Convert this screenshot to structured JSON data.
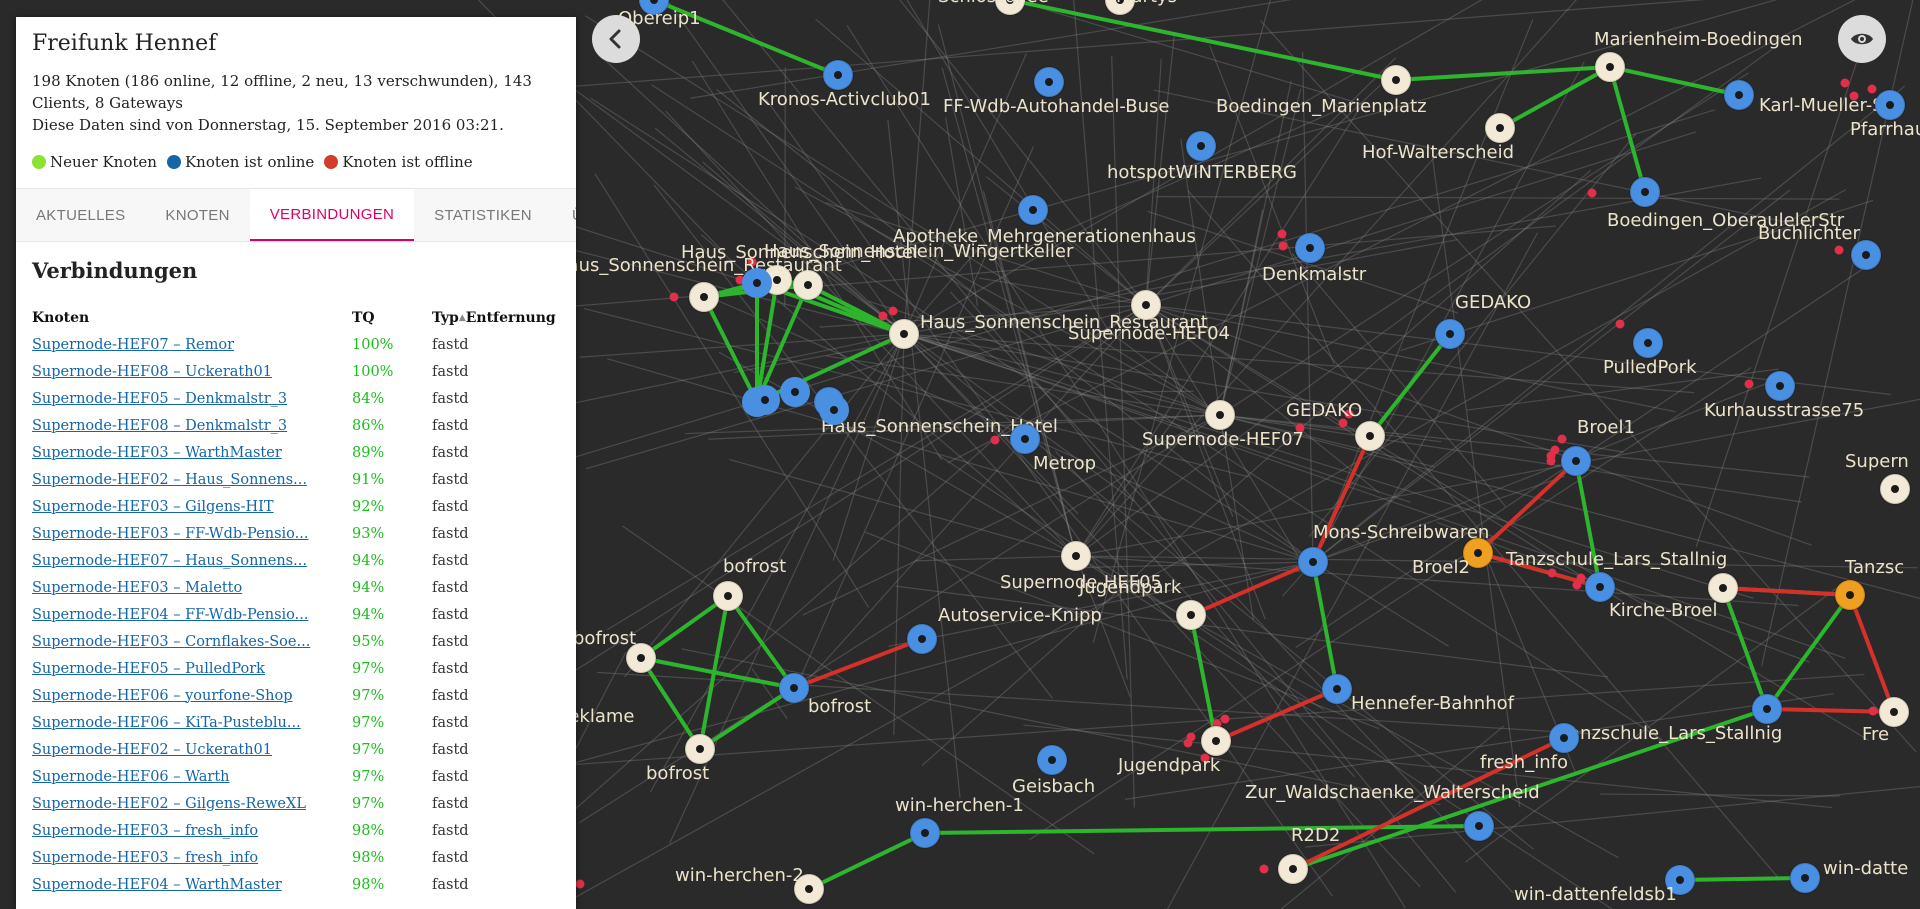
{
  "header": {
    "title": "Freifunk Hennef",
    "stats_line": "198 Knoten (186 online, 12 offline, 2 neu, 13 verschwunden), 143 Clients, 8 Gateways",
    "date_line": "Diese Daten sind von Donnerstag, 15. September 2016 03:21."
  },
  "legend": [
    {
      "label": "Neuer Knoten",
      "color": "#8ae234"
    },
    {
      "label": "Knoten ist online",
      "color": "#1566a9"
    },
    {
      "label": "Knoten ist offline",
      "color": "#d23c2c"
    }
  ],
  "tabs": [
    {
      "label": "AKTUELLES",
      "active": false
    },
    {
      "label": "KNOTEN",
      "active": false
    },
    {
      "label": "VERBINDUNGEN",
      "active": true
    },
    {
      "label": "STATISTIKEN",
      "active": false
    },
    {
      "label": "ÜBER",
      "active": false
    }
  ],
  "connections": {
    "heading": "Verbindungen",
    "columns": {
      "knoten": "Knoten",
      "tq": "TQ",
      "typ": "Typ",
      "entfernung": "Entfernung",
      "sort_indicator": "▲"
    },
    "rows": [
      {
        "name": "Supernode-HEF07 – Remor",
        "tq": "100%",
        "typ": "fastd"
      },
      {
        "name": "Supernode-HEF08 – Uckerath01",
        "tq": "100%",
        "typ": "fastd"
      },
      {
        "name": "Supernode-HEF05 – Denkmalstr_3",
        "tq": "84%",
        "typ": "fastd"
      },
      {
        "name": "Supernode-HEF08 – Denkmalstr_3",
        "tq": "86%",
        "typ": "fastd"
      },
      {
        "name": "Supernode-HEF03 – WarthMaster",
        "tq": "89%",
        "typ": "fastd"
      },
      {
        "name": "Supernode-HEF02 – Haus_Sonnens...",
        "tq": "91%",
        "typ": "fastd"
      },
      {
        "name": "Supernode-HEF03 – Gilgens-HIT",
        "tq": "92%",
        "typ": "fastd"
      },
      {
        "name": "Supernode-HEF03 – FF-Wdb-Pensio...",
        "tq": "93%",
        "typ": "fastd"
      },
      {
        "name": "Supernode-HEF07 – Haus_Sonnens...",
        "tq": "94%",
        "typ": "fastd"
      },
      {
        "name": "Supernode-HEF03 – Maletto",
        "tq": "94%",
        "typ": "fastd"
      },
      {
        "name": "Supernode-HEF04 – FF-Wdb-Pensio...",
        "tq": "94%",
        "typ": "fastd"
      },
      {
        "name": "Supernode-HEF03 – Cornflakes-Soe...",
        "tq": "95%",
        "typ": "fastd"
      },
      {
        "name": "Supernode-HEF05 – PulledPork",
        "tq": "97%",
        "typ": "fastd"
      },
      {
        "name": "Supernode-HEF06 – yourfone-Shop",
        "tq": "97%",
        "typ": "fastd"
      },
      {
        "name": "Supernode-HEF06 – KiTa-Pusteblu...",
        "tq": "97%",
        "typ": "fastd"
      },
      {
        "name": "Supernode-HEF02 – Uckerath01",
        "tq": "97%",
        "typ": "fastd"
      },
      {
        "name": "Supernode-HEF06 – Warth",
        "tq": "97%",
        "typ": "fastd"
      },
      {
        "name": "Supernode-HEF02 – Gilgens-ReweXL",
        "tq": "97%",
        "typ": "fastd"
      },
      {
        "name": "Supernode-HEF03 – fresh_info",
        "tq": "98%",
        "typ": "fastd"
      },
      {
        "name": "Supernode-HEF03 – fresh_info",
        "tq": "98%",
        "typ": "fastd"
      },
      {
        "name": "Supernode-HEF04 – WarthMaster",
        "tq": "98%",
        "typ": "fastd"
      }
    ]
  },
  "map": {
    "colors": {
      "background": "#2a2a2a",
      "online": "#4a90e2",
      "gateway": "#f2ead6",
      "warning": "#f0a020",
      "good_link": "#2db52d",
      "bad_link": "#d6302a",
      "faint_link": "#8a8a8a",
      "client": "#e0304a"
    },
    "nodes": [
      {
        "label": "Obereip1"
      },
      {
        "label": "Kronos-Activclub01"
      },
      {
        "label": "FF-Wdb-Autohandel-Buse"
      },
      {
        "label": "Schlossallee"
      },
      {
        "label": "Martys"
      },
      {
        "label": "Boedingen_Marienplatz"
      },
      {
        "label": "Marienheim-Boedingen"
      },
      {
        "label": "Karl-Mueller-Str"
      },
      {
        "label": "Pfarrhaus-Hap"
      },
      {
        "label": "Hof-Walterscheid"
      },
      {
        "label": "hotspotWINTERBERG"
      },
      {
        "label": "Boedingen_OberaulelerStr"
      },
      {
        "label": "Buchlichter"
      },
      {
        "label": "Apotheke_Mehrgenerationenhaus"
      },
      {
        "label": "Denkmalstr"
      },
      {
        "label": "Haus_Sonnenschein_Hotel"
      },
      {
        "label": "Haus_Sonnenschein_Wingertkeller"
      },
      {
        "label": "Haus_Sonnenschein_Restaurant"
      },
      {
        "label": "Haus_Sonnenschein_Restaurant"
      },
      {
        "label": "Supernode-HEF04"
      },
      {
        "label": "GEDAKO"
      },
      {
        "label": "PulledPork"
      },
      {
        "label": "Kurhausstrasse75"
      },
      {
        "label": "Haus_Sonnenschein_Hotel"
      },
      {
        "label": "Metrop"
      },
      {
        "label": "Supernode-HEF07"
      },
      {
        "label": "GEDAKO"
      },
      {
        "label": "Broel1"
      },
      {
        "label": "Mons-Schreibwaren"
      },
      {
        "label": "Broel2"
      },
      {
        "label": "Tanzschule_Lars_Stallnig"
      },
      {
        "label": "Kirche-Broel"
      },
      {
        "label": "Tanzsc"
      },
      {
        "label": "Supern"
      },
      {
        "label": "bofrost"
      },
      {
        "label": "Supernode-HEF05"
      },
      {
        "label": "Jugendpark"
      },
      {
        "label": "Autoservice-Knipp"
      },
      {
        "label": "bofrost"
      },
      {
        "label": "bofrost"
      },
      {
        "label": "bofrost"
      },
      {
        "label": "Hennefer-Bahnhof"
      },
      {
        "label": "Jugendpark"
      },
      {
        "label": "Geisbach"
      },
      {
        "label": "Tanzschule_Lars_Stallnig"
      },
      {
        "label": "fresh_info"
      },
      {
        "label": "Fre"
      },
      {
        "label": "Zur_Waldschaenke_Walterscheid"
      },
      {
        "label": "win-herchen-1"
      },
      {
        "label": "win-herchen-2"
      },
      {
        "label": "R2D2"
      },
      {
        "label": "win-dattenfeldsb1"
      },
      {
        "label": "win-datte"
      },
      {
        "label": "EDEL_Reklame"
      }
    ]
  },
  "controls": {
    "back_icon": "chevron-left-icon",
    "view_icon": "eye-icon"
  }
}
